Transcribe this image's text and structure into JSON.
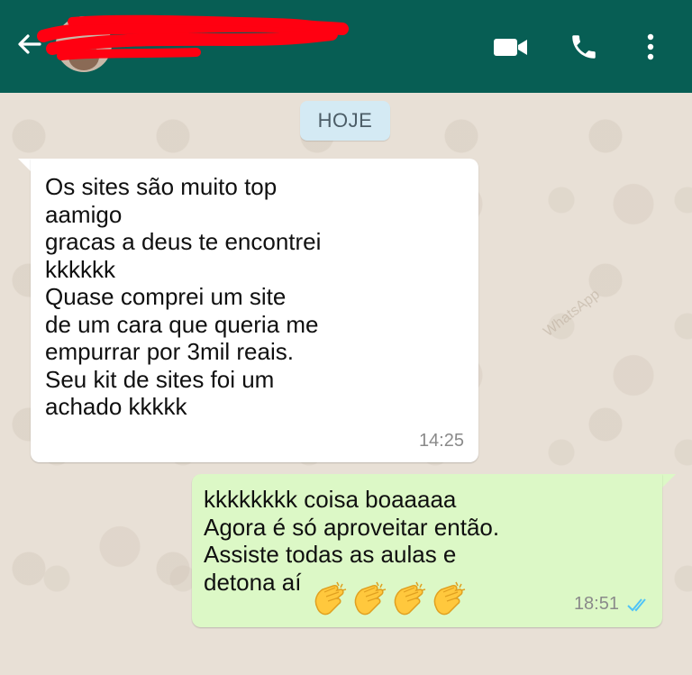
{
  "header": {
    "contact_name": "",
    "icons": {
      "back": "arrow-left-icon",
      "video": "video-call-icon",
      "phone": "phone-call-icon",
      "menu": "more-vert-icon"
    },
    "colors": {
      "bar": "#075e54",
      "redaction": "#ff0011"
    }
  },
  "chat": {
    "date_label": "HOJE",
    "watermark": "WhatsApp",
    "messages": [
      {
        "direction": "incoming",
        "text": "Os sites são muito top\naamigo\ngracas a deus te encontrei\nkkkkkk\nQuase comprei um site\nde um cara que queria me\nempurrar por 3mil reais.\nSeu kit de sites foi um\nachado kkkkk",
        "time": "14:25"
      },
      {
        "direction": "outgoing",
        "text": "kkkkkkkk coisa boaaaaa\nAgora é só aproveitar então.\nAssiste todas as aulas e\ndetona aí",
        "emoji": "👏👏👏👏",
        "time": "18:51",
        "status": "read"
      }
    ],
    "colors": {
      "incoming": "#ffffff",
      "outgoing": "#dcf8c6",
      "date_chip": "#d4eaf4",
      "read_ticks": "#4fc3f7"
    }
  }
}
